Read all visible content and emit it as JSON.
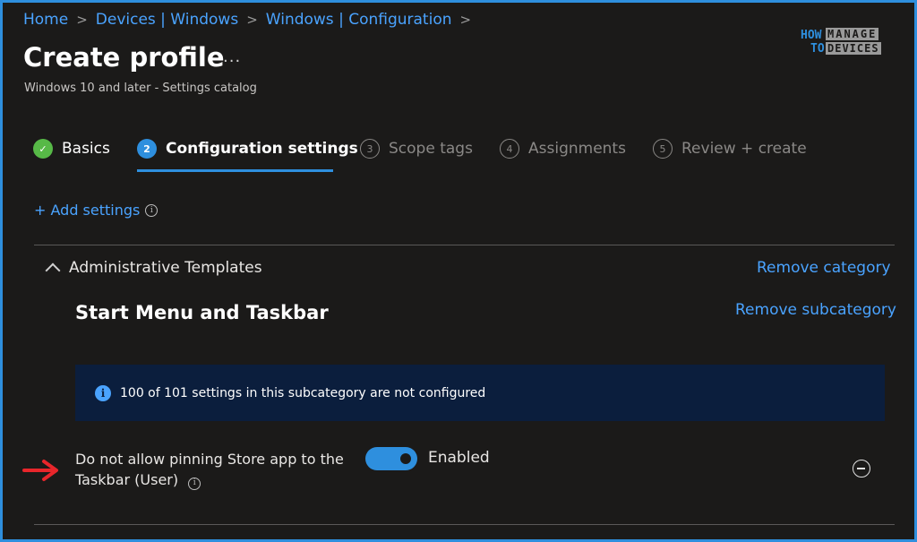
{
  "breadcrumb": [
    "Home",
    "Devices | Windows",
    "Windows | Configuration"
  ],
  "header": {
    "title": "Create profile",
    "more": "...",
    "subtitle": "Windows 10 and later - Settings catalog"
  },
  "logo": {
    "how": "HOW",
    "to": "TO",
    "manage": "MANAGE",
    "devices": "DEVICES"
  },
  "steps": [
    {
      "num": "✓",
      "label": "Basics",
      "state": "done"
    },
    {
      "num": "2",
      "label": "Configuration settings",
      "state": "active"
    },
    {
      "num": "3",
      "label": "Scope tags",
      "state": "pending"
    },
    {
      "num": "4",
      "label": "Assignments",
      "state": "pending"
    },
    {
      "num": "5",
      "label": "Review + create",
      "state": "pending"
    }
  ],
  "add_settings": "+ Add settings",
  "category": {
    "name": "Administrative Templates",
    "remove_label": "Remove category",
    "subcategory": {
      "name": "Start Menu and Taskbar",
      "remove_label": "Remove subcategory"
    }
  },
  "info_banner": {
    "text": "100 of 101 settings in this subcategory are not configured"
  },
  "setting": {
    "label_line1": "Do not allow pinning Store app to the",
    "label_line2": "Taskbar (User)",
    "toggle_on": true,
    "state_text": "Enabled"
  },
  "colors": {
    "accent": "#2e8fde",
    "link": "#4aa3ff",
    "success": "#57b947",
    "arrow": "#e8262b",
    "banner": "#0b1e3d"
  }
}
